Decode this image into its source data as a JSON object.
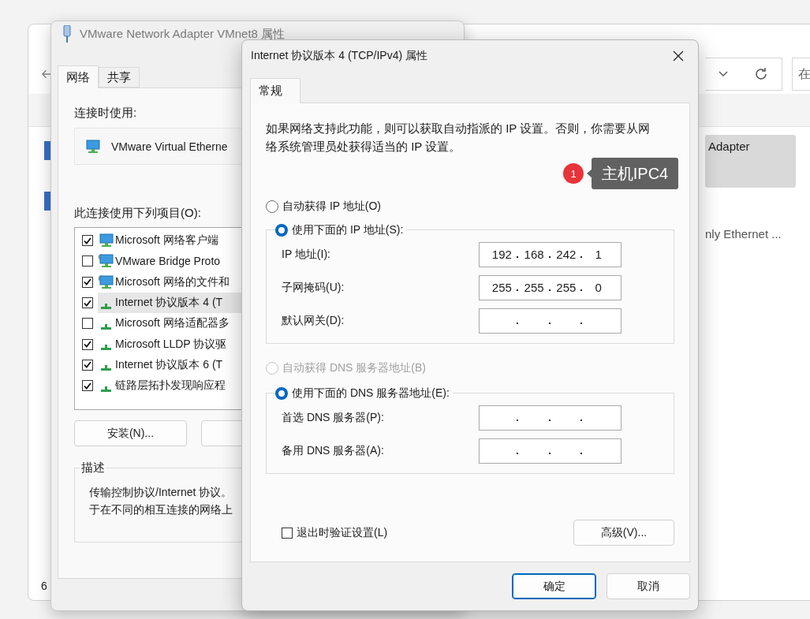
{
  "explorer_window": {
    "search_placeholder": "在",
    "items": [
      {
        "label": "Adapter",
        "selected": true
      },
      {
        "label": "nly Ethernet ...",
        "selected": false
      }
    ],
    "status": "6"
  },
  "adapter_window": {
    "title": "VMware Network Adapter VMnet8 属性",
    "tabs": [
      {
        "label": "网络",
        "selected": true
      },
      {
        "label": "共享",
        "selected": false
      }
    ],
    "connect_using_label": "连接时使用:",
    "adapter_name": "VMware Virtual Etherne",
    "items_label": "此连接使用下列项目(O):",
    "items": [
      {
        "label": "Microsoft 网络客户端",
        "checked": true,
        "selected": false,
        "kind": "client"
      },
      {
        "label": "VMware Bridge Proto",
        "checked": false,
        "selected": false,
        "kind": "service"
      },
      {
        "label": "Microsoft 网络的文件和",
        "checked": true,
        "selected": false,
        "kind": "service"
      },
      {
        "label": "Internet 协议版本 4 (T",
        "checked": true,
        "selected": true,
        "kind": "protocol"
      },
      {
        "label": "Microsoft 网络适配器多",
        "checked": false,
        "selected": false,
        "kind": "protocol"
      },
      {
        "label": "Microsoft LLDP 协议驱",
        "checked": true,
        "selected": false,
        "kind": "protocol"
      },
      {
        "label": "Internet 协议版本 6 (T",
        "checked": true,
        "selected": false,
        "kind": "protocol"
      },
      {
        "label": "链路层拓扑发现响应程",
        "checked": true,
        "selected": false,
        "kind": "protocol"
      }
    ],
    "install_button": "安装(N)...",
    "description_title": "描述",
    "description_lines": [
      "传输控制协议/Internet 协议。",
      "于在不同的相互连接的网络上"
    ]
  },
  "ipv4_dialog": {
    "title": "Internet 协议版本 4 (TCP/IPv4) 属性",
    "tabs": [
      {
        "label": "常规",
        "selected": true
      }
    ],
    "intro": "如果网络支持此功能，则可以获取自动指派的 IP 设置。否则，你需要从网络系统管理员处获得适当的 IP 设置。",
    "ip_mode": [
      {
        "label": "自动获得 IP 地址(O)",
        "selected": false,
        "disabled": false
      },
      {
        "label": "使用下面的 IP 地址(S):",
        "selected": true,
        "disabled": false
      }
    ],
    "ip_fields": [
      {
        "label": "IP 地址(I):",
        "octets": [
          "192",
          "168",
          "242",
          "1"
        ]
      },
      {
        "label": "子网掩码(U):",
        "octets": [
          "255",
          "255",
          "255",
          "0"
        ]
      },
      {
        "label": "默认网关(D):"
      }
    ],
    "dns_mode": [
      {
        "label": "自动获得 DNS 服务器地址(B)",
        "selected": false,
        "disabled": true
      },
      {
        "label": "使用下面的 DNS 服务器地址(E):",
        "selected": true,
        "disabled": false
      }
    ],
    "dns_fields": [
      {
        "label": "首选 DNS 服务器(P):"
      },
      {
        "label": "备用 DNS 服务器(A):"
      }
    ],
    "validate_on_exit": {
      "label": "退出时验证设置(L)",
      "checked": false
    },
    "advanced_button": "高级(V)...",
    "ok_button": "确定",
    "cancel_button": "取消"
  },
  "annotation": {
    "number": "1",
    "text": "主机IPC4"
  }
}
